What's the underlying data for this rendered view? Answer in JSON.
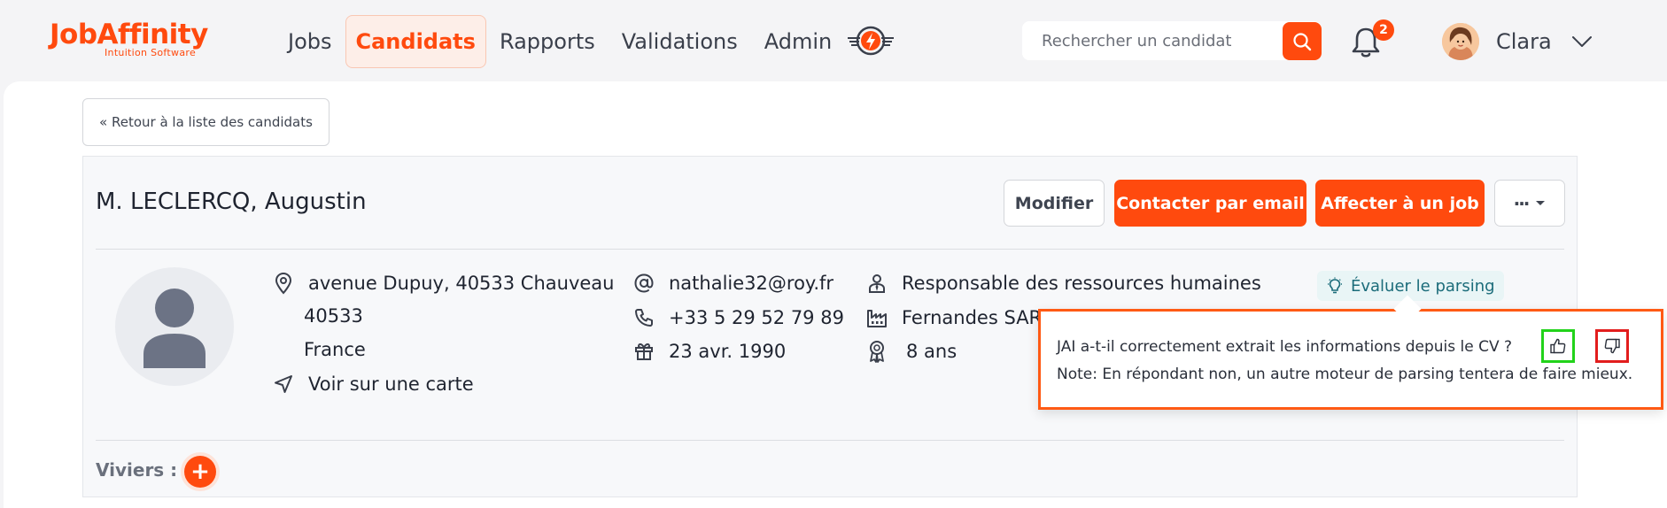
{
  "header": {
    "logo_main": "JobAffinity",
    "logo_sub": "Intuition Software",
    "nav": [
      "Jobs",
      "Candidats",
      "Rapports",
      "Validations",
      "Admin"
    ],
    "active_nav": "Candidats",
    "search_placeholder": "Rechercher un candidat",
    "notifications_count": "2",
    "user_name": "Clara"
  },
  "page": {
    "back_label": "« Retour à la liste des candidats",
    "candidate_name": "M. LECLERCQ, Augustin",
    "actions": {
      "modify": "Modifier",
      "contact": "Contacter par email",
      "assign": "Affecter à un job",
      "more": "···"
    }
  },
  "candidate": {
    "address_line1": "avenue Dupuy, 40533 Chauveau",
    "address_line2": "40533",
    "country": "France",
    "map_link": "Voir sur une carte",
    "email": "nathalie32@roy.fr",
    "phone": "+33 5 29 52 79 89",
    "birthdate": "23 avr. 1990",
    "job_title": "Responsable des ressources humaines",
    "company": "Fernandes SAR",
    "experience": "8 ans"
  },
  "parsing": {
    "eval_label": "Évaluer le parsing",
    "question": "JAI a-t-il correctement extrait les informations depuis le CV ?",
    "note": "Note: En répondant non, un autre moteur de parsing tentera de faire mieux."
  },
  "viviers": {
    "label": "Viviers :",
    "add": "+"
  },
  "colors": {
    "brand": "#ff4a0e",
    "accent_teal": "#1b6c7a",
    "thumb_up_highlight": "#22d31a",
    "thumb_down_highlight": "#e21d1d"
  }
}
